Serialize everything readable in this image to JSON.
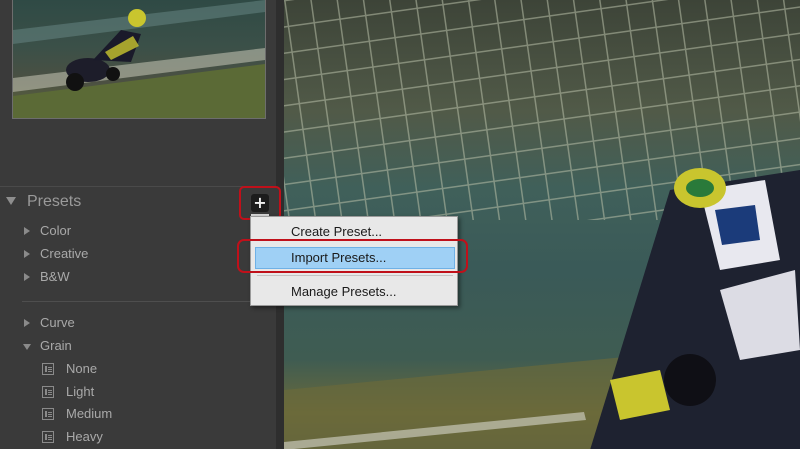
{
  "panel": {
    "section_title": "Presets",
    "add_button_icon": "plus-icon"
  },
  "presets": {
    "groups_top": [
      {
        "label": "Color",
        "expanded": false
      },
      {
        "label": "Creative",
        "expanded": false
      },
      {
        "label": "B&W",
        "expanded": false
      }
    ],
    "groups_bottom": [
      {
        "label": "Curve",
        "expanded": false
      },
      {
        "label": "Grain",
        "expanded": true,
        "children": [
          "None",
          "Light",
          "Medium",
          "Heavy"
        ]
      }
    ]
  },
  "context_menu": {
    "items": [
      "Create Preset...",
      "Import Presets...",
      "Manage Presets..."
    ],
    "highlighted_index": 1
  },
  "colors": {
    "highlight_frame": "#c0101a",
    "menu_highlight": "#9fd0f5"
  }
}
